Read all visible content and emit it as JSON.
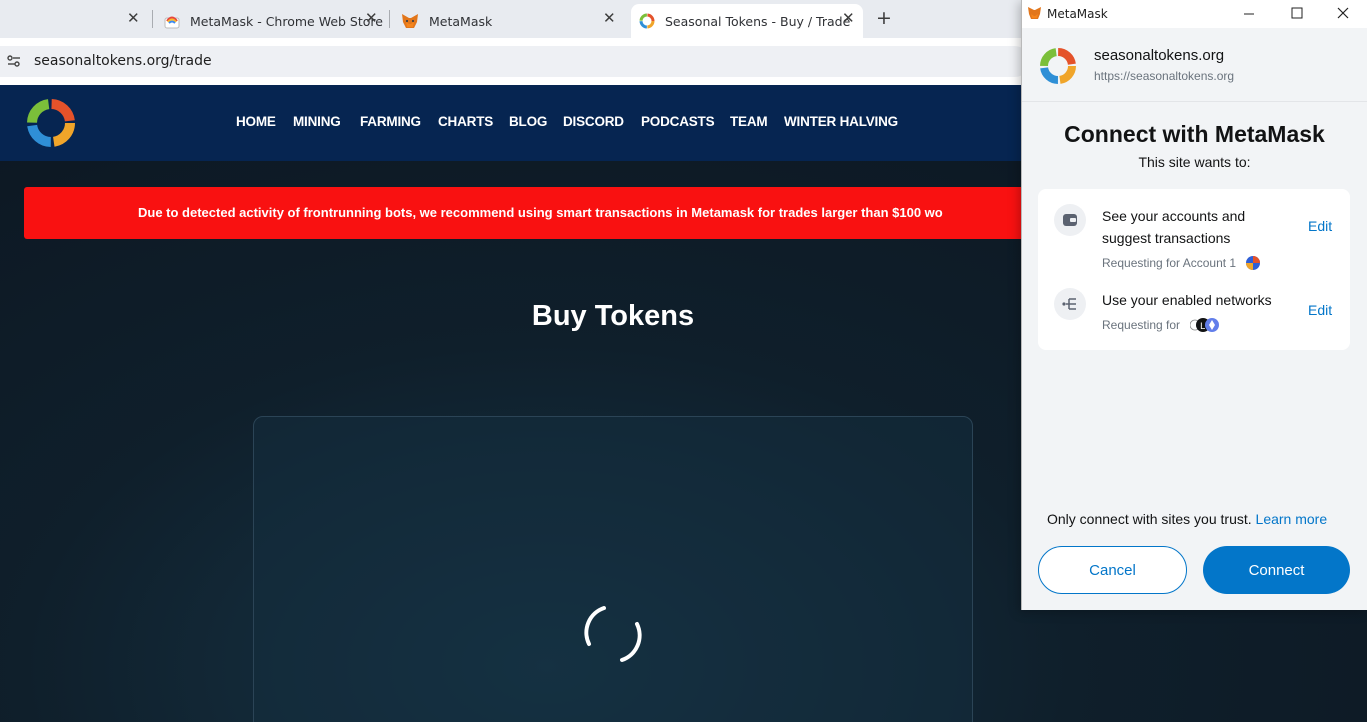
{
  "browser": {
    "tabs": [
      {
        "label": "MetaMask - Chrome Web Store",
        "icon": "chrome-web-store-icon"
      },
      {
        "label": "MetaMask",
        "icon": "metamask-fox-icon"
      },
      {
        "label": "Seasonal Tokens - Buy / Trade",
        "icon": "seasonal-tokens-icon",
        "active": true
      }
    ],
    "url": "seasonaltokens.org/trade"
  },
  "site": {
    "nav": [
      "HOME",
      "MINING",
      "FARMING",
      "CHARTS",
      "BLOG",
      "DISCORD",
      "PODCASTS",
      "TEAM",
      "WINTER HALVING"
    ],
    "alert": "Due to detected activity of frontrunning bots, we recommend using smart transactions in Metamask for trades larger than $100 wo",
    "title": "Buy Tokens",
    "colors": {
      "nav_bg": "#062551",
      "alert_bg": "#f91111"
    }
  },
  "metamask": {
    "window_title": "MetaMask",
    "site_name": "seasonaltokens.org",
    "site_url": "https://seasonaltokens.org",
    "heading": "Connect with MetaMask",
    "subheading": "This site wants to:",
    "permissions": [
      {
        "line1": "See your accounts and",
        "line2": "suggest transactions",
        "sub": "Requesting for Account 1",
        "edit": "Edit",
        "icon": "wallet-icon"
      },
      {
        "line1": "Use your enabled networks",
        "sub": "Requesting for",
        "edit": "Edit",
        "icon": "network-icon"
      }
    ],
    "trust_text": "Only connect with sites you trust.",
    "learn_more": "Learn more",
    "cancel": "Cancel",
    "connect": "Connect",
    "accent": "#0376c9"
  }
}
